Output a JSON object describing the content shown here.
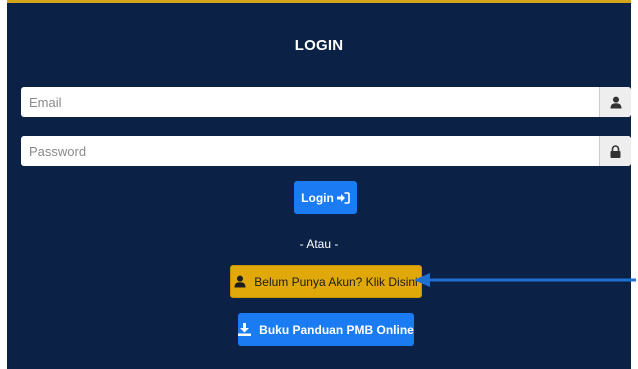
{
  "form": {
    "title": "LOGIN",
    "email_placeholder": "Email",
    "password_placeholder": "Password",
    "email_addon_icon": "user-icon",
    "password_addon_icon": "lock-icon",
    "login_label": "Login",
    "login_icon": "sign-in-icon",
    "separator": "- Atau -",
    "register_label": "Belum Punya Akun? Klik Disini",
    "register_icon": "user-icon",
    "guide_label": "Buku Panduan PMB Online",
    "guide_icon": "download-icon"
  },
  "colors": {
    "panel_background": "#0b2246",
    "panel_top_border": "#d4a41a",
    "primary_button": "#1a7bf2",
    "warning_button": "#e1a80a",
    "annotation_arrow": "#1f6fd1"
  }
}
